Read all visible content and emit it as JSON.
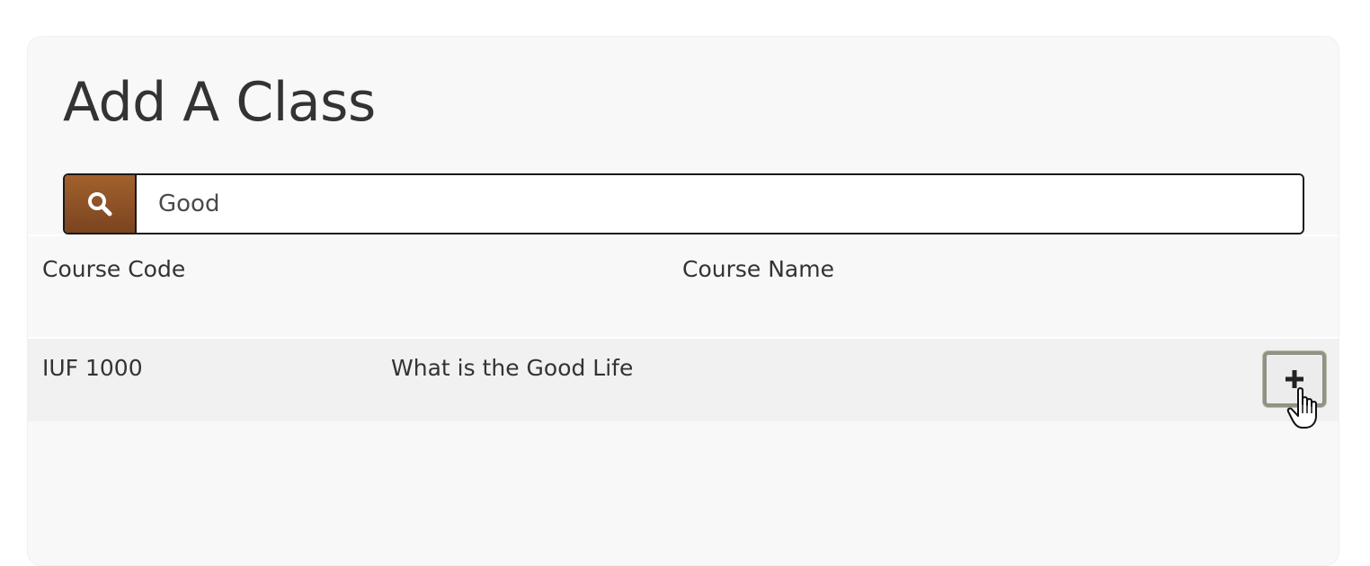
{
  "page": {
    "title": "Add A Class"
  },
  "search": {
    "icon": "search-icon",
    "value": "Good",
    "button_color": "#8e5127"
  },
  "table": {
    "columns": [
      "Course Code",
      "Course Name"
    ],
    "rows": [
      {
        "code": "IUF 1000",
        "name": "What is the Good Life",
        "action_icon": "plus-icon"
      }
    ]
  }
}
